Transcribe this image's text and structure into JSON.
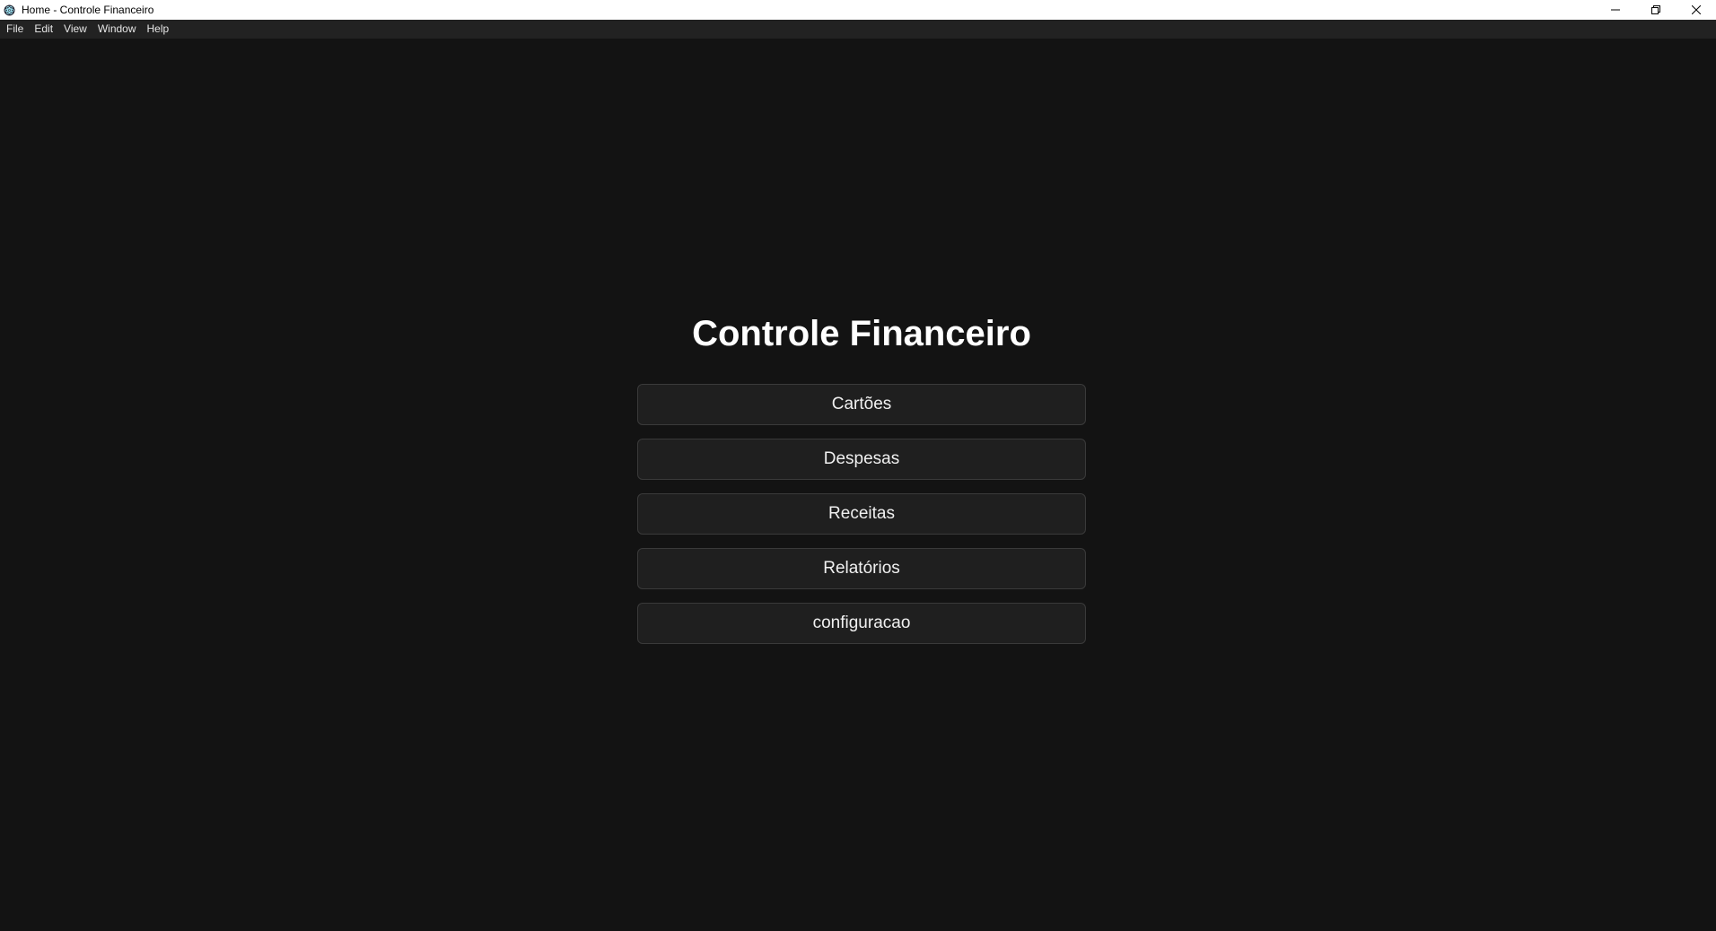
{
  "window": {
    "title": "Home - Controle Financeiro",
    "app_icon": "electron-atom-icon"
  },
  "menubar": {
    "items": [
      "File",
      "Edit",
      "View",
      "Window",
      "Help"
    ]
  },
  "main": {
    "title": "Controle Financeiro",
    "buttons": [
      "Cartões",
      "Despesas",
      "Receitas",
      "Relatórios",
      "configuracao"
    ]
  },
  "colors": {
    "background": "#131313",
    "menubar": "#222222",
    "button_bg": "#1f1f1f",
    "button_border": "#3a3a3a",
    "text": "#ffffff"
  }
}
